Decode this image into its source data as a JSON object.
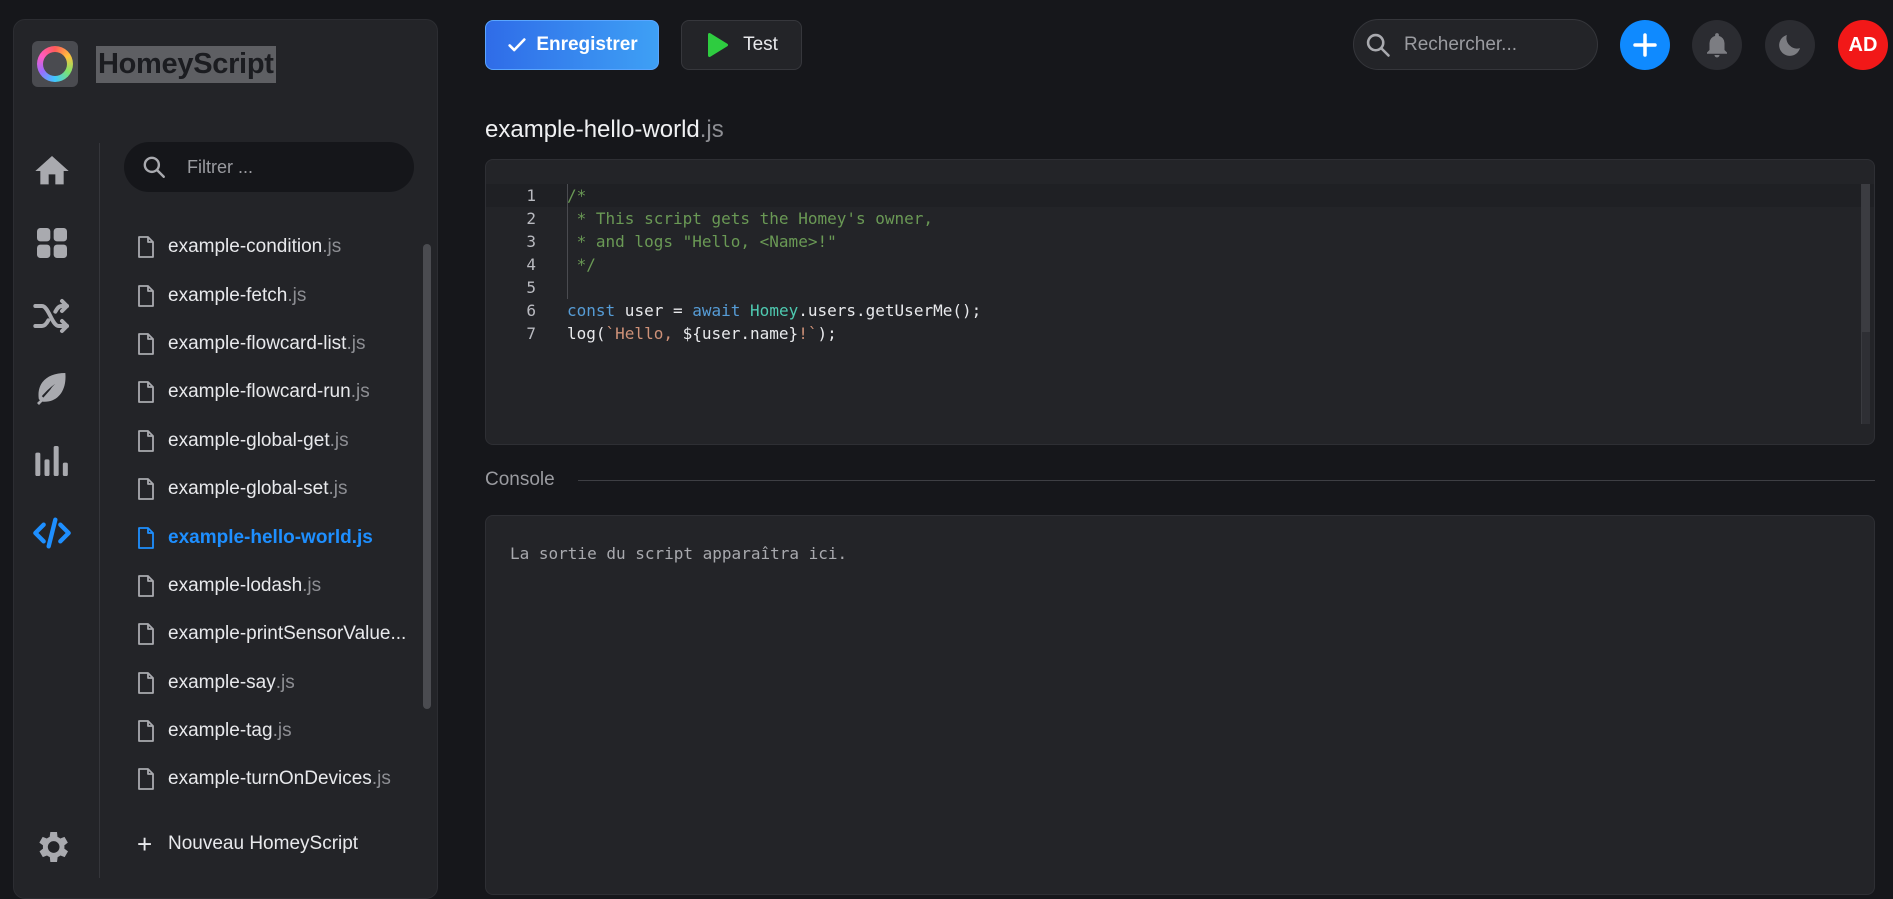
{
  "app": {
    "title": "HomeyScript"
  },
  "sidebar": {
    "filter_placeholder": "Filtrer ...",
    "nav": [
      {
        "name": "home-icon",
        "active": false
      },
      {
        "name": "dashboard-icon",
        "active": false
      },
      {
        "name": "flows-shuffle-icon",
        "active": false
      },
      {
        "name": "energy-leaf-icon",
        "active": false
      },
      {
        "name": "insights-chart-icon",
        "active": false
      },
      {
        "name": "code-icon",
        "active": true
      },
      {
        "name": "settings-gear-icon",
        "active": false
      }
    ],
    "files": [
      {
        "name": "example-condition",
        "ext": ".js",
        "active": false
      },
      {
        "name": "example-fetch",
        "ext": ".js",
        "active": false
      },
      {
        "name": "example-flowcard-list",
        "ext": ".js",
        "active": false
      },
      {
        "name": "example-flowcard-run",
        "ext": ".js",
        "active": false
      },
      {
        "name": "example-global-get",
        "ext": ".js",
        "active": false
      },
      {
        "name": "example-global-set",
        "ext": ".js",
        "active": false
      },
      {
        "name": "example-hello-world",
        "ext": ".js",
        "active": true
      },
      {
        "name": "example-lodash",
        "ext": ".js",
        "active": false
      },
      {
        "name": "example-printSensorValue...",
        "ext": "",
        "active": false
      },
      {
        "name": "example-say",
        "ext": ".js",
        "active": false
      },
      {
        "name": "example-tag",
        "ext": ".js",
        "active": false
      },
      {
        "name": "example-turnOnDevices",
        "ext": ".js",
        "active": false
      }
    ],
    "new_script_label": "Nouveau HomeyScript"
  },
  "toolbar": {
    "save_label": "Enregistrer",
    "test_label": "Test",
    "search_placeholder": "Rechercher...",
    "avatar_initials": "AD"
  },
  "editor": {
    "file_name": "example-hello-world",
    "file_ext": ".js",
    "lines": [
      {
        "n": "1",
        "tokens": [
          {
            "t": "/*",
            "c": "c-com"
          }
        ]
      },
      {
        "n": "2",
        "tokens": [
          {
            "t": " * This script gets the Homey's owner,",
            "c": "c-com"
          }
        ]
      },
      {
        "n": "3",
        "tokens": [
          {
            "t": " * and logs \"Hello, <Name>!\"",
            "c": "c-com"
          }
        ]
      },
      {
        "n": "4",
        "tokens": [
          {
            "t": " */",
            "c": "c-com"
          }
        ]
      },
      {
        "n": "5",
        "tokens": [
          {
            "t": "",
            "c": "c-txt"
          }
        ]
      },
      {
        "n": "6",
        "tokens": [
          {
            "t": "const",
            "c": "c-kw"
          },
          {
            "t": " user = ",
            "c": "c-txt"
          },
          {
            "t": "await",
            "c": "c-kw"
          },
          {
            "t": " ",
            "c": "c-txt"
          },
          {
            "t": "Homey",
            "c": "c-obj"
          },
          {
            "t": ".users.getUserMe();",
            "c": "c-txt"
          }
        ]
      },
      {
        "n": "7",
        "tokens": [
          {
            "t": "log(",
            "c": "c-txt"
          },
          {
            "t": "`Hello, ",
            "c": "c-str"
          },
          {
            "t": "${user.name}",
            "c": "c-txt"
          },
          {
            "t": "!`",
            "c": "c-str"
          },
          {
            "t": ");",
            "c": "c-txt"
          }
        ]
      }
    ]
  },
  "console": {
    "label": "Console",
    "output": "La sortie du script apparaîtra ici."
  },
  "colors": {
    "accent": "#1e8fff",
    "save_button": "#2f6ce8",
    "add_button": "#0f8aff",
    "avatar": "#f21818",
    "background": "#16171b",
    "panel": "#232428"
  }
}
